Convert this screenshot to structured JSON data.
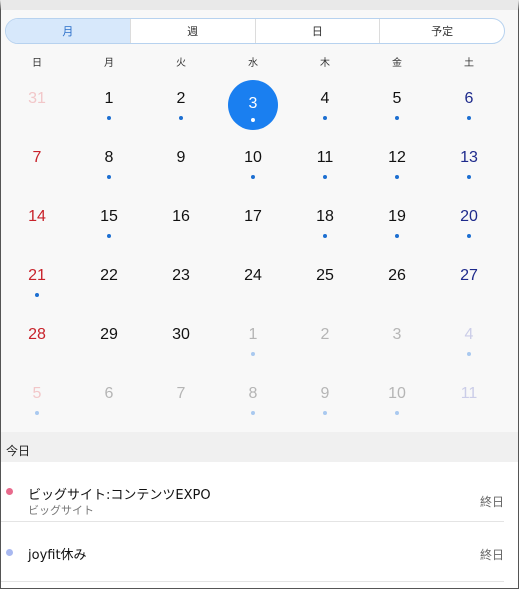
{
  "tabs": [
    {
      "label": "月",
      "active": true
    },
    {
      "label": "週",
      "active": false
    },
    {
      "label": "日",
      "active": false
    },
    {
      "label": "予定",
      "active": false
    }
  ],
  "weekdays": [
    "日",
    "月",
    "火",
    "水",
    "木",
    "金",
    "土"
  ],
  "weeks": [
    [
      {
        "n": "31",
        "other": true,
        "dot": false
      },
      {
        "n": "1",
        "dot": true
      },
      {
        "n": "2",
        "dot": true
      },
      {
        "n": "3",
        "dot": true,
        "today": true
      },
      {
        "n": "4",
        "dot": true
      },
      {
        "n": "5",
        "dot": true
      },
      {
        "n": "6",
        "dot": true
      }
    ],
    [
      {
        "n": "7",
        "dot": false
      },
      {
        "n": "8",
        "dot": true
      },
      {
        "n": "9",
        "dot": false
      },
      {
        "n": "10",
        "dot": true
      },
      {
        "n": "11",
        "dot": true
      },
      {
        "n": "12",
        "dot": true
      },
      {
        "n": "13",
        "dot": true
      }
    ],
    [
      {
        "n": "14",
        "dot": false
      },
      {
        "n": "15",
        "dot": true
      },
      {
        "n": "16",
        "dot": false
      },
      {
        "n": "17",
        "dot": false
      },
      {
        "n": "18",
        "dot": true
      },
      {
        "n": "19",
        "dot": true
      },
      {
        "n": "20",
        "dot": true
      }
    ],
    [
      {
        "n": "21",
        "dot": true
      },
      {
        "n": "22",
        "dot": false
      },
      {
        "n": "23",
        "dot": false
      },
      {
        "n": "24",
        "dot": false
      },
      {
        "n": "25",
        "dot": false
      },
      {
        "n": "26",
        "dot": false
      },
      {
        "n": "27",
        "dot": false
      }
    ],
    [
      {
        "n": "28",
        "dot": false
      },
      {
        "n": "29",
        "dot": false
      },
      {
        "n": "30",
        "dot": false
      },
      {
        "n": "1",
        "other": true,
        "dot": true
      },
      {
        "n": "2",
        "other": true,
        "dot": false
      },
      {
        "n": "3",
        "other": true,
        "dot": false
      },
      {
        "n": "4",
        "other": true,
        "dot": true
      }
    ],
    [
      {
        "n": "5",
        "other": true,
        "dot": true
      },
      {
        "n": "6",
        "other": true,
        "dot": false
      },
      {
        "n": "7",
        "other": true,
        "dot": false
      },
      {
        "n": "8",
        "other": true,
        "dot": true
      },
      {
        "n": "9",
        "other": true,
        "dot": true
      },
      {
        "n": "10",
        "other": true,
        "dot": true
      },
      {
        "n": "11",
        "other": true,
        "dot": false
      }
    ]
  ],
  "today_section": {
    "header": "今日",
    "events": [
      {
        "title": "ビッグサイト:コンテンツEXPO",
        "location": "ビッグサイト",
        "allday": "終日",
        "color": "#e86a8c"
      },
      {
        "title": "joyfit休み",
        "location": "",
        "allday": "終日",
        "color": "#a8b8f0"
      }
    ]
  },
  "colors": {
    "accent": "#1a7ff0",
    "sunday": "#c8222a",
    "saturday": "#1e2a8c",
    "event_dot": "#1d6fd1"
  }
}
